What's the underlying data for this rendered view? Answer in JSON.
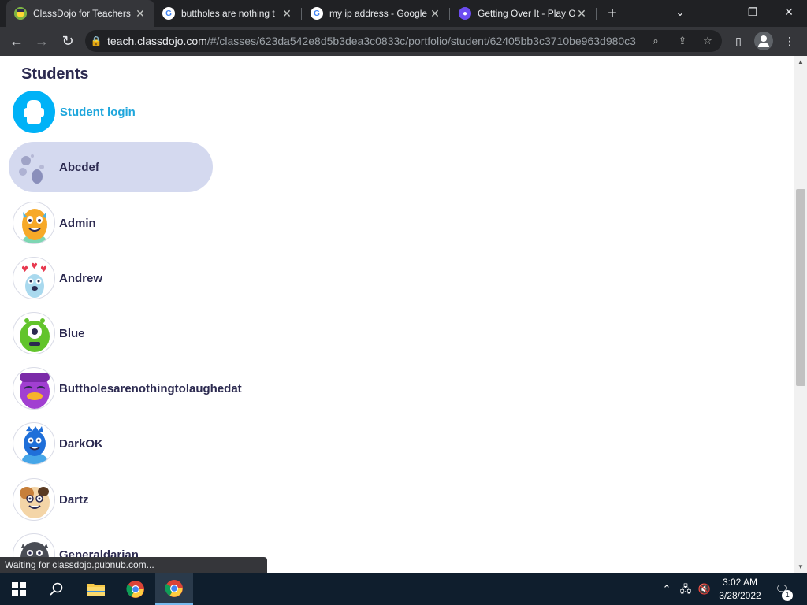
{
  "browser": {
    "tabs": [
      {
        "title": "ClassDojo for Teachers",
        "favicon": "classdojo-icon",
        "active": true
      },
      {
        "title": "buttholes are nothing t",
        "favicon": "google-icon",
        "active": false
      },
      {
        "title": "my ip address - Google",
        "favicon": "google-icon",
        "active": false
      },
      {
        "title": "Getting Over It - Play O",
        "favicon": "poki-icon",
        "active": false
      }
    ],
    "new_tab_label": "+",
    "address": {
      "host": "teach.classdojo.com",
      "path": "/#/classes/623da542e8d5b3dea3c0833c/portfolio/student/62405bb3c3710be963d980c3"
    },
    "status_text": "Waiting for classdojo.pubnub.com..."
  },
  "page": {
    "heading": "Students",
    "student_login_label": "Student login",
    "students": [
      {
        "name": "Abcdef",
        "avatar": "moon-rock-avatar",
        "selected": true
      },
      {
        "name": "Admin",
        "avatar": "orange-monster-avatar",
        "selected": false
      },
      {
        "name": "Andrew",
        "avatar": "hearts-monster-avatar",
        "selected": false
      },
      {
        "name": "Blue",
        "avatar": "green-monster-avatar",
        "selected": false
      },
      {
        "name": "Buttholesarenothingtolaughedat",
        "avatar": "purple-monster-avatar",
        "selected": false
      },
      {
        "name": "DarkOK",
        "avatar": "blue-monster-avatar",
        "selected": false
      },
      {
        "name": "Dartz",
        "avatar": "hamster-monster-avatar",
        "selected": false
      },
      {
        "name": "Generaldarian",
        "avatar": "gray-monster-avatar",
        "selected": false
      }
    ]
  },
  "taskbar": {
    "time": "3:02 AM",
    "date": "3/28/2022",
    "notification_count": "1"
  }
}
